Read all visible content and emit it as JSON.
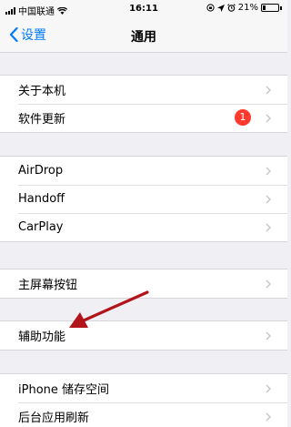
{
  "status_bar": {
    "carrier": "中国联通",
    "time": "16:11",
    "battery_percent": "21%",
    "battery_level": 0.21
  },
  "nav": {
    "back_label": "设置",
    "title": "通用"
  },
  "groups": [
    {
      "items": [
        {
          "label": "关于本机"
        },
        {
          "label": "软件更新",
          "badge": "1"
        }
      ]
    },
    {
      "items": [
        {
          "label": "AirDrop"
        },
        {
          "label": "Handoff"
        },
        {
          "label": "CarPlay"
        }
      ]
    },
    {
      "items": [
        {
          "label": "主屏幕按钮"
        }
      ]
    },
    {
      "items": [
        {
          "label": "辅助功能"
        }
      ]
    },
    {
      "items": [
        {
          "label": "iPhone 储存空间"
        },
        {
          "label": "后台应用刷新"
        }
      ]
    }
  ],
  "colors": {
    "accent": "#007aff",
    "badge": "#ff3b30",
    "annotation_arrow": "#b3141b"
  }
}
